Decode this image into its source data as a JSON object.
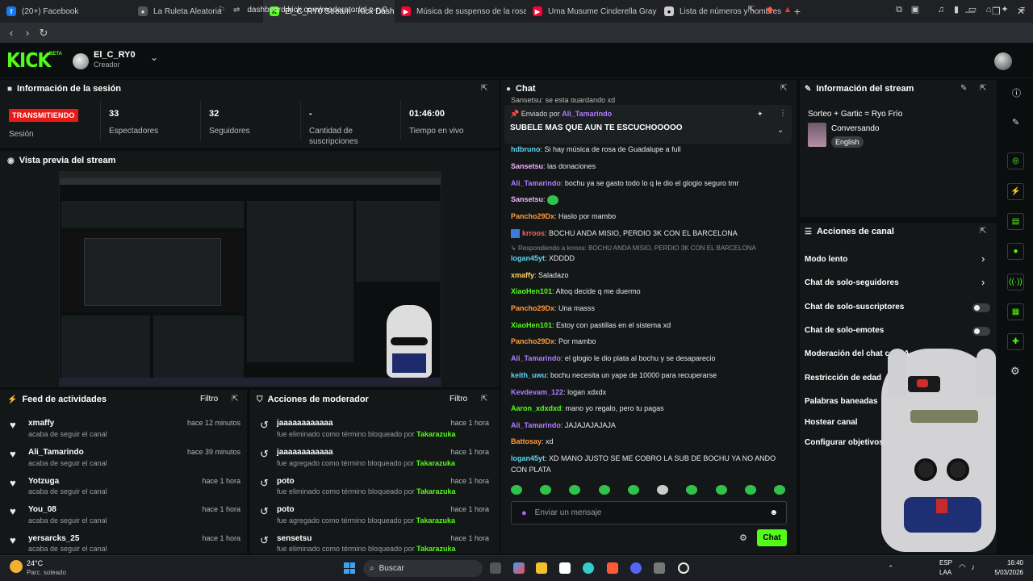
{
  "browser": {
    "tabs": [
      {
        "title": "(20+) Facebook",
        "fav": "f",
        "color": "#1877f2"
      },
      {
        "title": "La Ruleta Aleatoria",
        "fav": "●",
        "color": "#888888"
      },
      {
        "title": "El_C_RY0 Stream - Kick Dashboa",
        "fav": "K",
        "color": "#53fc18",
        "active": true
      },
      {
        "title": "Música de suspenso de la rosa de gu",
        "fav": "▶",
        "color": "#ff0033"
      },
      {
        "title": "Uma Musume Cinderella Gray Opening",
        "fav": "▶",
        "color": "#ff0033"
      },
      {
        "title": "Lista de números y nombres",
        "fav": "●",
        "color": "#cccccc"
      }
    ],
    "url": "dashboard.kick.com/moderator/el-c-ry0"
  },
  "header": {
    "logo": "KICK",
    "beta": "BETA",
    "username": "El_C_RY0",
    "role": "Creador"
  },
  "session": {
    "title": "Información de la sesión",
    "status": "TRANSMITIENDO",
    "status_label": "Sesión",
    "stats": [
      {
        "value": "33",
        "label": "Espectadores"
      },
      {
        "value": "32",
        "label": "Seguidores"
      },
      {
        "value": "-",
        "label": "Cantidad de suscripciones"
      },
      {
        "value": "01:46:00",
        "label": "Tiempo en vivo"
      }
    ]
  },
  "preview": {
    "title": "Vista previa del stream"
  },
  "activity": {
    "title": "Feed de actividades",
    "filter": "Filtro",
    "items": [
      {
        "name": "xmaffy",
        "desc": "acaba de seguir el canal",
        "time": "hace 12 minutos"
      },
      {
        "name": "Ali_Tamarindo",
        "desc": "acaba de seguir el canal",
        "time": "hace 39 minutos"
      },
      {
        "name": "Yotzuga",
        "desc": "acaba de seguir el canal",
        "time": "hace 1 hora"
      },
      {
        "name": "You_08",
        "desc": "acaba de seguir el canal",
        "time": "hace 1 hora"
      },
      {
        "name": "yersarcks_25",
        "desc": "acaba de seguir el canal",
        "time": "hace 1 hora"
      }
    ]
  },
  "modactions": {
    "title": "Acciones de moderador",
    "filter": "Filtro",
    "items": [
      {
        "term": "jaaaaaaaaaaaa",
        "desc": "fue eliminado como término bloqueado por",
        "by": "Takarazuka",
        "time": "hace 1 hora"
      },
      {
        "term": "jaaaaaaaaaaaa",
        "desc": "fue agregado como término bloqueado por",
        "by": "Takarazuka",
        "time": "hace 1 hora"
      },
      {
        "term": "poto",
        "desc": "fue eliminado como término bloqueado por",
        "by": "Takarazuka",
        "time": "hace 1 hora"
      },
      {
        "term": "poto",
        "desc": "fue agregado como término bloqueado por",
        "by": "Takarazuka",
        "time": "hace 1 hora"
      },
      {
        "term": "sensetsu",
        "desc": "fue eliminado como término bloqueado por",
        "by": "Takarazuka",
        "time": "hace 1 hora"
      }
    ]
  },
  "chat": {
    "title": "Chat",
    "top_partial": "Sansetsu: se esta guardando xd",
    "pinned": {
      "by_prefix": "Enviado por",
      "by": "Ali_Tamarindo",
      "text": "SUBELE MAS QUE AUN TE ESCUCHOOOOO"
    },
    "messages": [
      {
        "user": "hdbruno",
        "color": "#5fd3f3",
        "text": "Si hay música de rosa de Guadalupe a full"
      },
      {
        "user": "Sansetsu",
        "color": "#f0b2ff",
        "text": "las donaciones"
      },
      {
        "user": "Ali_Tamarindo",
        "color": "#b07cff",
        "text": "bochu ya se gasto todo lo q le dio el glogio seguro tmr"
      },
      {
        "user": "Sansetsu",
        "color": "#f0b2ff",
        "text": "",
        "emote": true
      },
      {
        "user": "Pancho29Dx",
        "color": "#ff9b3d",
        "text": "Haslo por mambo"
      },
      {
        "user": "krroos",
        "color": "#ff5f5f",
        "text": "BOCHU ANDA MISIO, PERDIO 3K CON EL BARCELONA",
        "badge": true
      },
      {
        "user": "",
        "color": "#888888",
        "text": "Respondiendo a krroos: BOCHU ANDA MISIO, PERDIO 3K CON EL BARCELONA",
        "reply": true
      },
      {
        "user": "logan45yt",
        "color": "#5fd3f3",
        "text": "XDDDD"
      },
      {
        "user": "xmaffy",
        "color": "#ffd35f",
        "text": "Saladazo"
      },
      {
        "user": "XiaoHen101",
        "color": "#53fc18",
        "text": "Altoq decide q me duermo"
      },
      {
        "user": "Pancho29Dx",
        "color": "#ff9b3d",
        "text": "Una masss"
      },
      {
        "user": "XiaoHen101",
        "color": "#53fc18",
        "text": "Estoy con pastillas en el sistema xd"
      },
      {
        "user": "Pancho29Dx",
        "color": "#ff9b3d",
        "text": "Por mambo"
      },
      {
        "user": "Ali_Tamarindo",
        "color": "#b07cff",
        "text": "el glogio le dio plata al bochu y se desaparecio"
      },
      {
        "user": "keith_uwu",
        "color": "#5fd3f3",
        "text": "bochu necesita un yape de 10000 para recuperarse"
      },
      {
        "user": "Kevdevam_122",
        "color": "#b07cff",
        "text": "logan xdxdx"
      },
      {
        "user": "Aaron_xdxdxd",
        "color": "#53fc18",
        "text": "mano yo regalo, pero tu pagas"
      },
      {
        "user": "Ali_Tamarindo",
        "color": "#b07cff",
        "text": "JAJAJAJAJAJA"
      },
      {
        "user": "Battosay",
        "color": "#ff9b3d",
        "text": "xd"
      },
      {
        "user": "logan45yt",
        "color": "#5fd3f3",
        "text": "XD MANO JUSTO SE ME COBRO LA SUB DE BOCHU YA NO ANDO CON PLATA"
      }
    ],
    "input_placeholder": "Enviar un mensaje",
    "send_label": "Chat"
  },
  "stream_info": {
    "title": "Información del stream",
    "stream_title": "Sorteo + Gartic = Ryo Frío",
    "category": "Conversando",
    "language": "English"
  },
  "channel_actions": {
    "title": "Acciones de canal",
    "items": [
      {
        "label": "Modo lento",
        "control": "arrow"
      },
      {
        "label": "Chat de solo-seguidores",
        "control": "arrow"
      },
      {
        "label": "Chat de solo-suscriptores",
        "control": "toggle"
      },
      {
        "label": "Chat de solo-emotes",
        "control": "toggle"
      },
      {
        "label": "Moderación del chat con IA",
        "control": "link"
      },
      {
        "label": "Restricción de edad",
        "control": "none"
      },
      {
        "label": "Palabras baneadas",
        "control": "none"
      },
      {
        "label": "Hostear canal",
        "control": "none"
      },
      {
        "label": "Configurar objetivos",
        "control": "none"
      }
    ]
  },
  "taskbar": {
    "weather_temp": "24°C",
    "weather_desc": "Parc. soleado",
    "search": "Buscar",
    "lang": "ESP",
    "region": "LAA",
    "time": "16:40",
    "date": "5/03/2026"
  }
}
